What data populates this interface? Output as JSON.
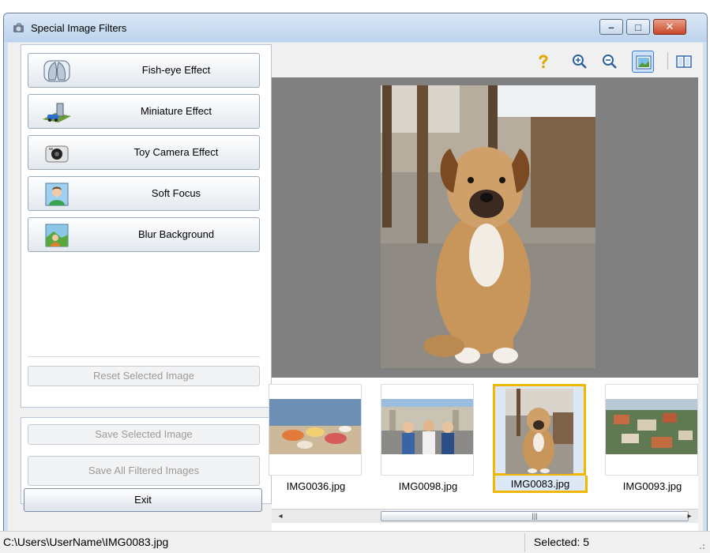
{
  "window": {
    "title": "Special Image Filters",
    "controls": {
      "minimize": "–",
      "maximize": "□",
      "close": "✕"
    }
  },
  "effects": [
    {
      "label": "Fish-eye Effect",
      "icon": "fisheye-icon"
    },
    {
      "label": "Miniature Effect",
      "icon": "miniature-icon"
    },
    {
      "label": "Toy Camera Effect",
      "icon": "camera-icon"
    },
    {
      "label": "Soft Focus",
      "icon": "portrait-icon"
    },
    {
      "label": "Blur Background",
      "icon": "landscape-icon"
    }
  ],
  "left": {
    "reset_label": "Reset Selected Image",
    "save_selected_label": "Save Selected Image",
    "save_all_label": "Save All Filtered Images",
    "exit_label": "Exit"
  },
  "toolbar": {
    "items": [
      "help-icon",
      "zoom-in-icon",
      "zoom-out-icon",
      "whole-image-view-icon",
      "compare-view-icon"
    ],
    "active": "whole-image-view-icon"
  },
  "thumbnails": [
    {
      "filename": "IMG0036.jpg",
      "selected": false
    },
    {
      "filename": "IMG0098.jpg",
      "selected": false
    },
    {
      "filename": "IMG0083.jpg",
      "selected": true
    },
    {
      "filename": "IMG0093.jpg",
      "selected": false
    }
  ],
  "scrollbar": {
    "left": "◂",
    "right": "▸",
    "grip": "|||"
  },
  "status": {
    "path": "C:\\Users\\UserName\\IMG0083.jpg",
    "selected": "Selected: 5"
  },
  "colors": {
    "selection_border": "#f0b800",
    "selection_fill": "#dce8f6",
    "active_tool": "#3d7bd0",
    "preview_bg": "#808080"
  }
}
